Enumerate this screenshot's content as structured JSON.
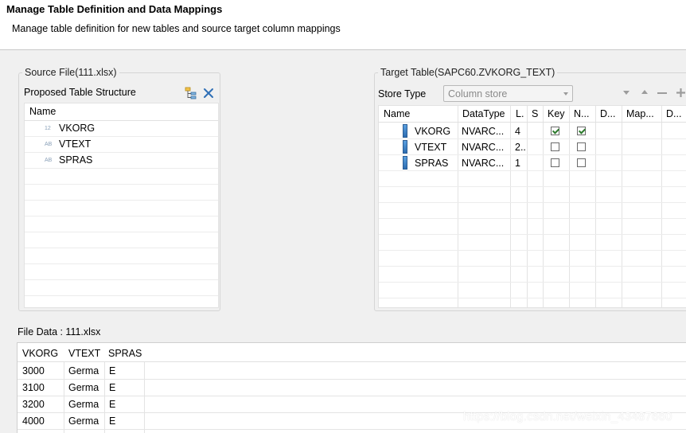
{
  "dialog": {
    "title": "Manage Table Definition and Data Mappings",
    "subtitle": "Manage table definition for new tables and source target column mappings"
  },
  "source": {
    "group_title": "Source File(111.xlsx)",
    "section_label": "Proposed Table Structure",
    "column_header": "Name",
    "rows": [
      {
        "type": "12",
        "name": "VKORG"
      },
      {
        "type": "AB",
        "name": "VTEXT"
      },
      {
        "type": "AB",
        "name": "SPRAS"
      }
    ]
  },
  "target": {
    "group_title": "Target Table(SAPC60.ZVKORG_TEXT)",
    "store_type_label": "Store Type",
    "store_type_value": "Column store",
    "headers": [
      "Name",
      "DataType",
      "L.",
      "S",
      "Key",
      "N...",
      "D...",
      "Map...",
      "D..."
    ],
    "rows": [
      {
        "name": "VKORG",
        "datatype": "NVARC...",
        "length": "4",
        "key": true,
        "notnull": true
      },
      {
        "name": "VTEXT",
        "datatype": "NVARC...",
        "length": "2..",
        "key": false,
        "notnull": false
      },
      {
        "name": "SPRAS",
        "datatype": "NVARC...",
        "length": "1",
        "key": false,
        "notnull": false
      }
    ]
  },
  "file_data": {
    "label": "File Data : 111.xlsx",
    "headers": [
      "VKORG",
      "VTEXT",
      "SPRAS"
    ],
    "rows": [
      [
        "3000",
        "Germa",
        "E"
      ],
      [
        "3100",
        "Germa",
        "E"
      ],
      [
        "3200",
        "Germa",
        "E"
      ],
      [
        "4000",
        "Germa",
        "E"
      ]
    ]
  },
  "watermark": "https://blog.csdn.net/weixin_43487660"
}
